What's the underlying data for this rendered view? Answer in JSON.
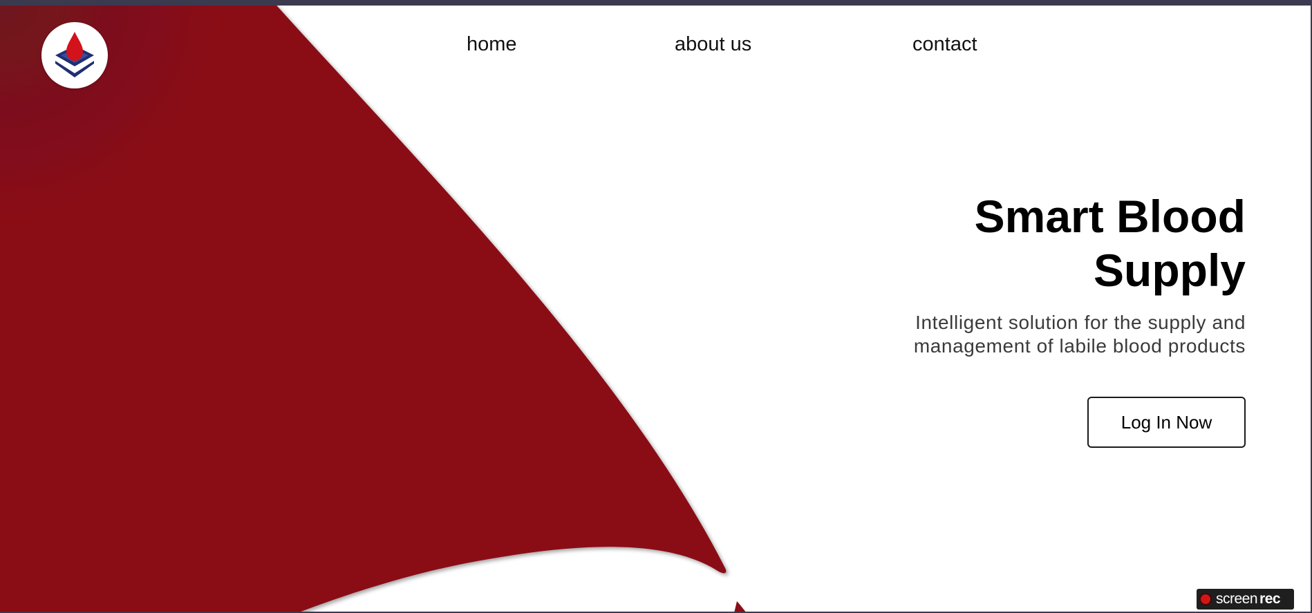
{
  "nav": {
    "items": [
      {
        "label": "home"
      },
      {
        "label": "about us"
      },
      {
        "label": "contact"
      }
    ]
  },
  "hero": {
    "title_line1": "Smart Blood",
    "title_line2": "Supply",
    "subtitle_line1": "Intelligent solution for the supply and",
    "subtitle_line2": "management of labile blood products",
    "cta_label": "Log In Now"
  },
  "recorder_badge": {
    "text_regular": "screen",
    "text_bold": "rec"
  },
  "icons": {
    "logo": "blood-drop-layers-icon",
    "recording": "record-dot-icon"
  },
  "colors": {
    "accent_red": "#8a0f18",
    "dark_red": "#6e1320",
    "logo_blue": "#1f2f73",
    "drop_red": "#d4121c",
    "frame": "#3b3a4f"
  }
}
